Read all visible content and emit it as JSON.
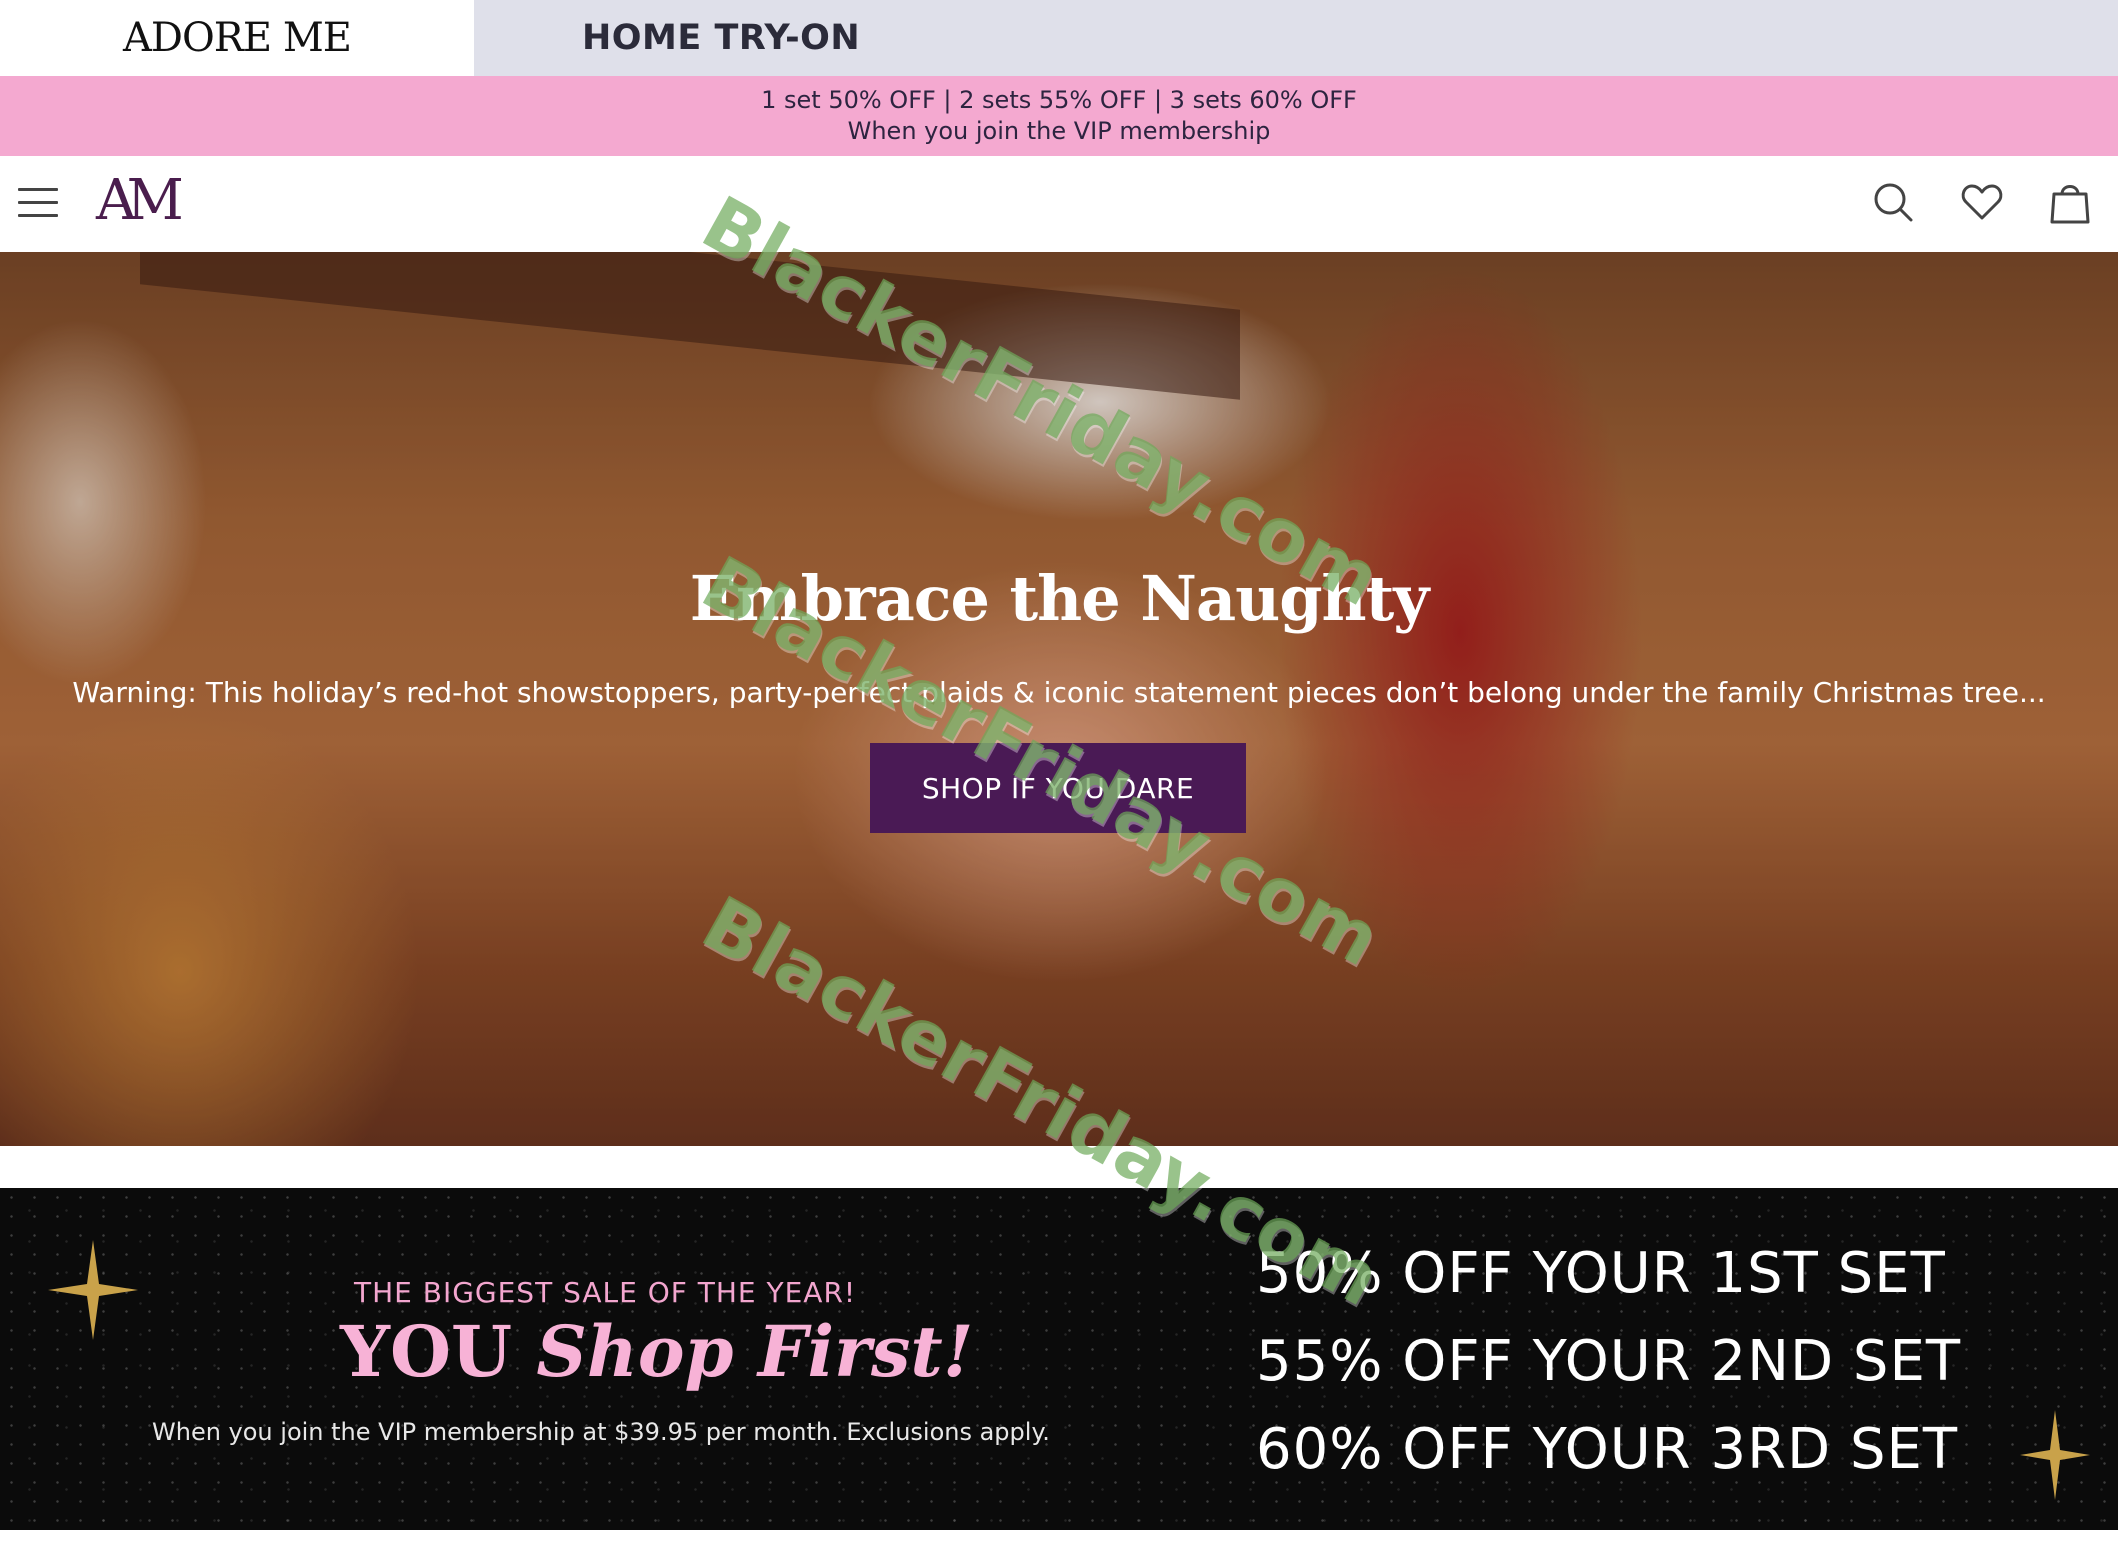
{
  "top_tabs": {
    "brand": "ADORE ME",
    "home_try_on": "HOME TRY-ON"
  },
  "promo_banner": {
    "line1": "1 set 50% OFF | 2 sets 55% OFF | 3 sets 60% OFF",
    "line2": "When you join the VIP membership"
  },
  "nav": {
    "logo": "AM",
    "icons": [
      "menu-icon",
      "search-icon",
      "heart-icon",
      "shopping-bag-icon"
    ]
  },
  "hero": {
    "title": "Embrace the Naughty",
    "subtitle": "Warning: This holiday’s red-hot showstoppers, party-perfect plaids & iconic statement pieces don’t belong under the family Christmas tree...",
    "cta": "SHOP IF YOU DARE"
  },
  "sale_banner": {
    "kicker": "THE BIGGEST SALE OF THE YEAR!",
    "headline_part1": "YOU",
    "headline_part2": "Shop First!",
    "note": "When you join the VIP membership at $39.95 per month. Exclusions apply.",
    "offers": [
      "50% OFF YOUR 1ST SET",
      "55% OFF YOUR 2ND SET",
      "60% OFF YOUR 3RD SET"
    ]
  },
  "watermark": "BlackerFriday.com",
  "colors": {
    "promo_pink": "#f4a9d0",
    "cta_purple": "#4a1a55",
    "logo_purple": "#4a1d4d",
    "tab_gray": "#dfe0ea",
    "sale_pink": "#f7b2d6"
  }
}
